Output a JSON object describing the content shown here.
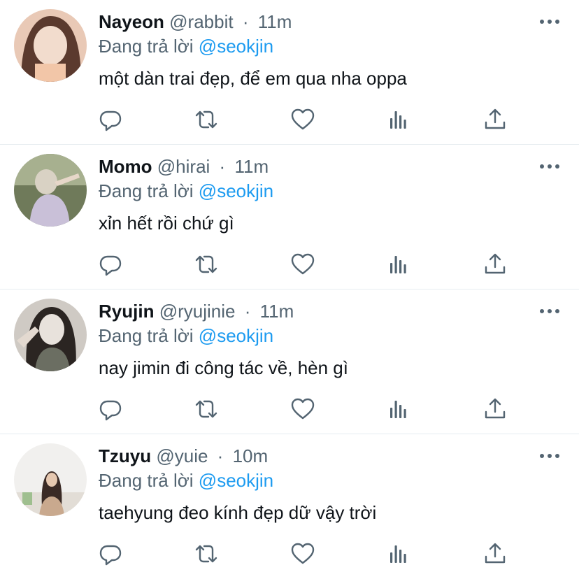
{
  "replies": [
    {
      "name": "Nayeon",
      "handle": "@rabbit",
      "separator": "·",
      "time": "11m",
      "reply_prefix": "Đang trả lời",
      "reply_to": "@seokjin",
      "text": "một dàn trai đẹp, để em qua nha oppa",
      "avatar_colors": [
        "#e9c9b6",
        "#5b3a2e",
        "#f2dccd"
      ]
    },
    {
      "name": "Momo",
      "handle": "@hirai",
      "separator": "·",
      "time": "11m",
      "reply_prefix": "Đang trả lời",
      "reply_to": "@seokjin",
      "text": "xỉn hết rồi chứ gì",
      "avatar_colors": [
        "#6f7a5a",
        "#d9d2c4",
        "#a7b08f"
      ]
    },
    {
      "name": "Ryujin",
      "handle": "@ryujinie",
      "separator": "·",
      "time": "11m",
      "reply_prefix": "Đang trả lời",
      "reply_to": "@seokjin",
      "text": "nay jimin đi công tác về, hèn gì",
      "avatar_colors": [
        "#cfcac4",
        "#2b2522",
        "#e8e2dc"
      ]
    },
    {
      "name": "Tzuyu",
      "handle": "@yuie",
      "separator": "·",
      "time": "10m",
      "reply_prefix": "Đang trả lời",
      "reply_to": "@seokjin",
      "text": "taehyung đeo kính đẹp dữ vậy trời",
      "avatar_colors": [
        "#f1f0ee",
        "#3a2a25",
        "#c9a98e"
      ]
    }
  ],
  "icons": {
    "reply": "reply-icon",
    "retweet": "retweet-icon",
    "like": "like-icon",
    "views": "views-icon",
    "share": "share-icon",
    "more": "more-icon"
  },
  "colors": {
    "name": "#0f1419",
    "secondary": "#536471",
    "mention": "#1d9bf0",
    "divider": "#e6ecf0"
  }
}
